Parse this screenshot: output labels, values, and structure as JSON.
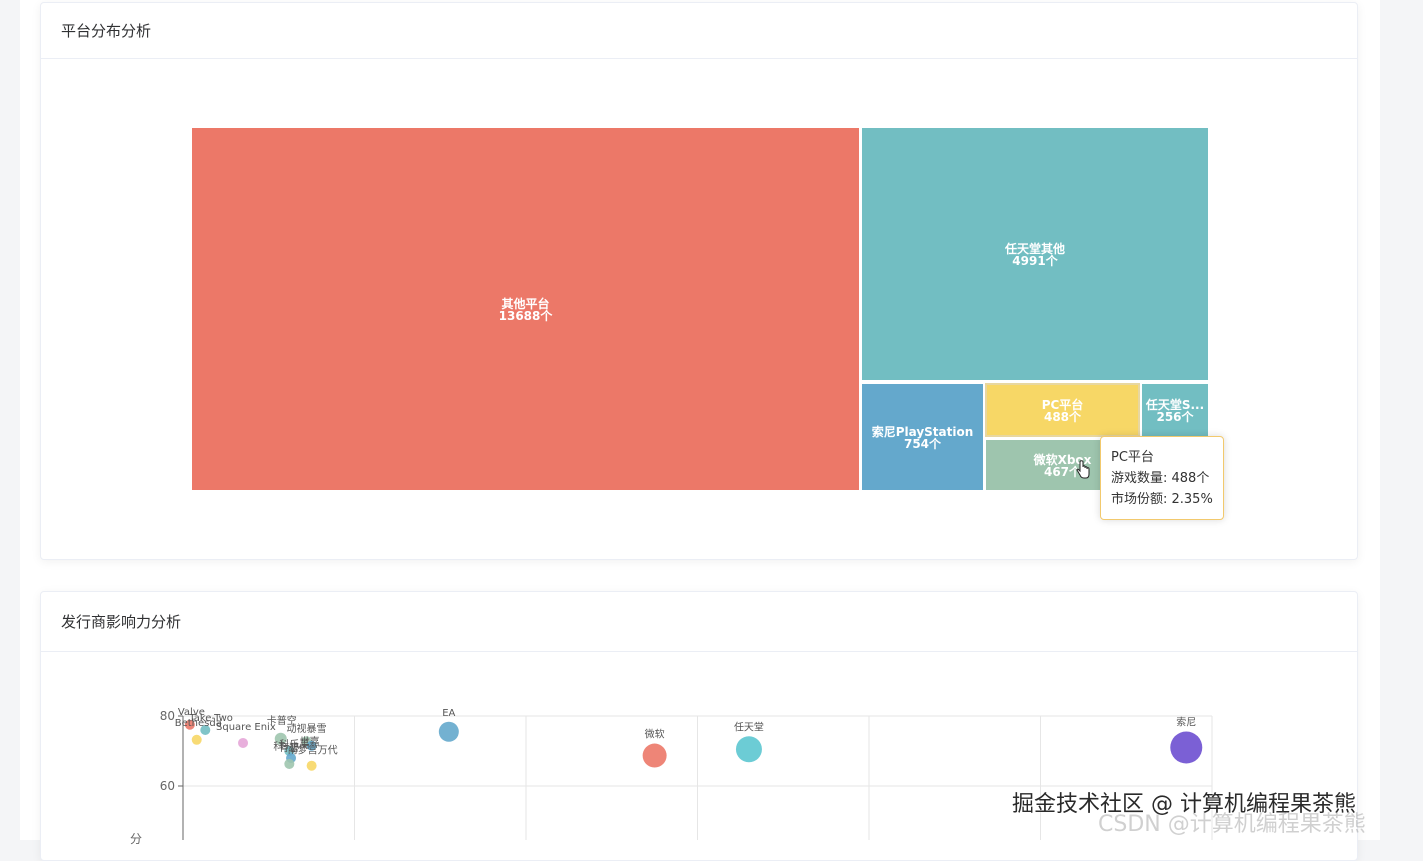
{
  "cards": {
    "platform_title": "平台分布分析",
    "publisher_title": "发行商影响力分析"
  },
  "chart_data": [
    {
      "type": "treemap",
      "nodes": [
        {
          "name": "其他平台",
          "value": 13688,
          "label": "13688个",
          "color": "#ec7868"
        },
        {
          "name": "任天堂其他",
          "value": 4991,
          "label": "4991个",
          "color": "#72bec2"
        },
        {
          "name": "索尼PlayStation",
          "value": 754,
          "label": "754个",
          "color": "#64a8cc"
        },
        {
          "name": "PC平台",
          "value": 488,
          "label": "488个",
          "color": "#f7d766"
        },
        {
          "name": "微软Xbox",
          "value": 467,
          "label": "467个",
          "color": "#9ec5ae"
        },
        {
          "name": "任天堂S...",
          "value": 256,
          "label": "256个",
          "color": "#72bec2"
        }
      ],
      "tooltip": {
        "title": "PC平台",
        "line1": "游戏数量: 488个",
        "line2": "市场份额: 2.35%"
      }
    },
    {
      "type": "scatter",
      "ylim": [
        55,
        80
      ],
      "yticks": [
        60,
        80
      ],
      "ylabel": "分",
      "points": [
        {
          "name": "Valve",
          "x": 0.4,
          "y": 77.5,
          "r": 5,
          "color": "#ec7868"
        },
        {
          "name": "Take-Two",
          "x": 1.3,
          "y": 76.0,
          "r": 5,
          "color": "#72bec2"
        },
        {
          "name": "Bethesda",
          "x": 0.8,
          "y": 73.2,
          "r": 5,
          "color": "#f7d766"
        },
        {
          "name": "Square Enix",
          "x": 3.5,
          "y": 72.3,
          "r": 5,
          "color": "#e6a6d8"
        },
        {
          "name": "卡普空",
          "x": 5.7,
          "y": 73.5,
          "r": 6,
          "color": "#9ec5ae"
        },
        {
          "name": "动视暴雪",
          "x": 7.2,
          "y": 72.8,
          "r": 5,
          "color": "#9ec5ae"
        },
        {
          "name": "世嘉",
          "x": 7.5,
          "y": 71.5,
          "r": 5,
          "color": "#64a8cc"
        },
        {
          "name": "科乐美",
          "x": 6.2,
          "y": 70.0,
          "r": 5,
          "color": "#72bec2"
        },
        {
          "name": "育碧",
          "x": 6.3,
          "y": 68.0,
          "r": 5,
          "color": "#64a8cc"
        },
        {
          "name": "南梦宫万代",
          "x": 7.5,
          "y": 65.8,
          "r": 5,
          "color": "#f7d766"
        },
        {
          "name": "科",
          "x": 6.2,
          "y": 66.3,
          "r": 5,
          "color": "#9ec5ae"
        },
        {
          "name": "EA",
          "x": 15.5,
          "y": 75.5,
          "r": 10,
          "color": "#64a8cc"
        },
        {
          "name": "微软",
          "x": 27.5,
          "y": 68.7,
          "r": 12,
          "color": "#ec7868"
        },
        {
          "name": "任天堂",
          "x": 33.0,
          "y": 70.5,
          "r": 13,
          "color": "#5cc6d0"
        },
        {
          "name": "索尼",
          "x": 58.5,
          "y": 71.0,
          "r": 16,
          "color": "#6d4fd0"
        }
      ]
    }
  ],
  "watermark": "掘金技术社区 @ 计算机编程果茶熊",
  "watermark_ghost": "CSDN @计算机编程果茶熊"
}
